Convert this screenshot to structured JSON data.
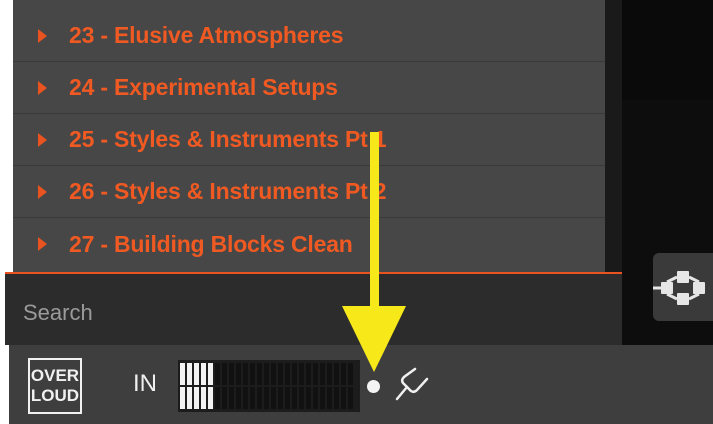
{
  "presets": {
    "items": [
      {
        "label": "23 - Elusive Atmospheres"
      },
      {
        "label": "24 - Experimental Setups"
      },
      {
        "label": "25 - Styles & Instruments Pt 1"
      },
      {
        "label": "26 - Styles & Instruments Pt 2"
      },
      {
        "label": "27 - Building Blocks Clean"
      }
    ]
  },
  "search": {
    "placeholder": "Search"
  },
  "footer": {
    "logo_line1": "OVER",
    "logo_line2": "LOUD",
    "input_label": "IN",
    "meter_top_level": 0.2,
    "meter_bottom_level": 0.2
  },
  "icons": {
    "caret": "caret-right-icon",
    "routing": "routing-icon",
    "status": "status-dot-icon",
    "tuner": "tuning-fork-icon",
    "annotation": "yellow-arrow-annotation"
  },
  "colors": {
    "accent": "#f05a22",
    "annotation": "#f7e81a",
    "panel": "#474747",
    "bar": "#3e3e3e"
  }
}
